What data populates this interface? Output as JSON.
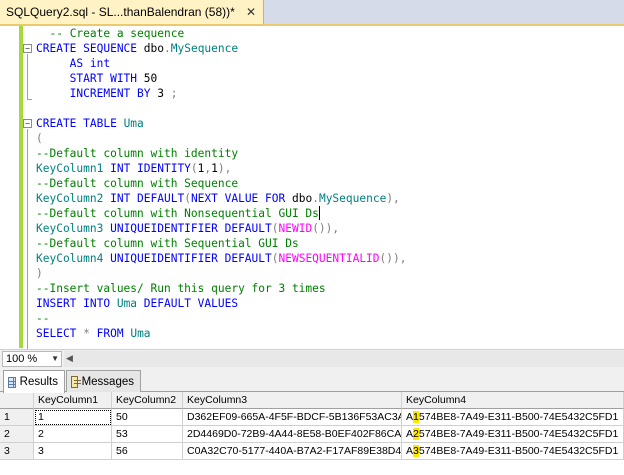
{
  "tab": {
    "title": "SQLQuery2.sql - SL...thanBalendran (58))*",
    "close_glyph": "✕"
  },
  "editor": {
    "lines": [
      [
        {
          "t": "  ",
          "c": "tx"
        },
        {
          "t": "-- Create a sequence",
          "c": "cm"
        }
      ],
      [
        {
          "t": "CREATE SEQUENCE ",
          "c": "kw"
        },
        {
          "t": "dbo",
          "c": "tx"
        },
        {
          "t": ".",
          "c": "op"
        },
        {
          "t": "MySequence",
          "c": "obj"
        }
      ],
      [
        {
          "t": "     AS ",
          "c": "kw"
        },
        {
          "t": "int",
          "c": "kw"
        }
      ],
      [
        {
          "t": "     START WITH ",
          "c": "kw"
        },
        {
          "t": "50",
          "c": "tx"
        }
      ],
      [
        {
          "t": "     INCREMENT BY ",
          "c": "kw"
        },
        {
          "t": "3 ",
          "c": "tx"
        },
        {
          "t": ";",
          "c": "op"
        }
      ],
      [],
      [
        {
          "t": "CREATE TABLE ",
          "c": "kw"
        },
        {
          "t": "Uma",
          "c": "obj"
        }
      ],
      [
        {
          "t": "(",
          "c": "op"
        }
      ],
      [
        {
          "t": "--Default column with identity",
          "c": "cm"
        }
      ],
      [
        {
          "t": "KeyColumn1 ",
          "c": "obj"
        },
        {
          "t": "INT IDENTITY",
          "c": "kw"
        },
        {
          "t": "(",
          "c": "op"
        },
        {
          "t": "1",
          "c": "tx"
        },
        {
          "t": ",",
          "c": "op"
        },
        {
          "t": "1",
          "c": "tx"
        },
        {
          "t": "),",
          "c": "op"
        }
      ],
      [
        {
          "t": "--Default column with Sequence",
          "c": "cm"
        }
      ],
      [
        {
          "t": "KeyColumn2 ",
          "c": "obj"
        },
        {
          "t": "INT DEFAULT",
          "c": "kw"
        },
        {
          "t": "(",
          "c": "op"
        },
        {
          "t": "NEXT VALUE FOR ",
          "c": "kw"
        },
        {
          "t": "dbo",
          "c": "tx"
        },
        {
          "t": ".",
          "c": "op"
        },
        {
          "t": "MySequence",
          "c": "obj"
        },
        {
          "t": "),",
          "c": "op"
        }
      ],
      [
        {
          "t": "--Default column with Nonsequential GUI Ds",
          "c": "cm"
        }
      ],
      [
        {
          "t": "KeyColumn3 ",
          "c": "obj"
        },
        {
          "t": "UNIQUEIDENTIFIER DEFAULT",
          "c": "kw"
        },
        {
          "t": "(",
          "c": "op"
        },
        {
          "t": "NEWID",
          "c": "fn"
        },
        {
          "t": "()),",
          "c": "op"
        }
      ],
      [
        {
          "t": "--Default column with Sequential GUI Ds",
          "c": "cm"
        }
      ],
      [
        {
          "t": "KeyColumn4 ",
          "c": "obj"
        },
        {
          "t": "UNIQUEIDENTIFIER DEFAULT",
          "c": "kw"
        },
        {
          "t": "(",
          "c": "op"
        },
        {
          "t": "NEWSEQUENTIALID",
          "c": "fn"
        },
        {
          "t": "()),",
          "c": "op"
        }
      ],
      [
        {
          "t": ")",
          "c": "op"
        }
      ],
      [
        {
          "t": "--Insert values/ Run this query for 3 times",
          "c": "cm"
        }
      ],
      [
        {
          "t": "INSERT INTO ",
          "c": "kw"
        },
        {
          "t": "Uma ",
          "c": "obj"
        },
        {
          "t": "DEFAULT VALUES",
          "c": "kw"
        }
      ],
      [
        {
          "t": "--",
          "c": "cm"
        }
      ],
      [
        {
          "t": "SELECT ",
          "c": "kw"
        },
        {
          "t": "* ",
          "c": "op"
        },
        {
          "t": "FROM ",
          "c": "kw"
        },
        {
          "t": "Uma",
          "c": "obj"
        }
      ]
    ]
  },
  "zoom": {
    "value": "100 %"
  },
  "results": {
    "tabs": [
      {
        "label": "Results"
      },
      {
        "label": "Messages"
      }
    ],
    "columns": [
      "",
      "KeyColumn1",
      "KeyColumn2",
      "KeyColumn3",
      "KeyColumn4"
    ],
    "rows": [
      {
        "num": "1",
        "c1": "1",
        "c2": "50",
        "c3": "D362EF09-665A-4F5F-BDCF-5B136F53AC3A",
        "c4a": "A",
        "c4b": "1",
        "c4c": "574BE8-7A49-E311-B500-74E5432C5FD1"
      },
      {
        "num": "2",
        "c1": "2",
        "c2": "53",
        "c3": "2D4469D0-72B9-4A44-8E58-B0EF402F86CA",
        "c4a": "A",
        "c4b": "2",
        "c4c": "574BE8-7A49-E311-B500-74E5432C5FD1"
      },
      {
        "num": "3",
        "c1": "3",
        "c2": "56",
        "c3": "C0A32C70-5177-440A-B7A2-F17AF89E38D4",
        "c4a": "A",
        "c4b": "3",
        "c4c": "574BE8-7A49-E311-B500-74E5432C5FD1"
      }
    ]
  },
  "colors": {
    "keyword": "#0000ff",
    "comment": "#008000",
    "object": "#008080",
    "function": "#ff00ff",
    "highlight": "#ffe800"
  }
}
